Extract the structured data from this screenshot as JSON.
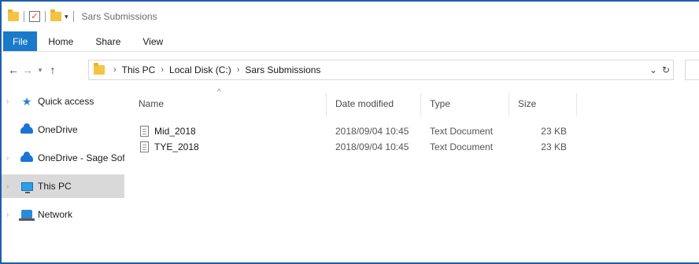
{
  "window": {
    "title": "Sars Submissions"
  },
  "ribbon": {
    "tabs": [
      "File",
      "Home",
      "Share",
      "View"
    ]
  },
  "address": {
    "crumbs": [
      "This PC",
      "Local Disk (C:)",
      "Sars Submissions"
    ]
  },
  "nav_pane": {
    "items": [
      {
        "label": "Quick access",
        "icon": "star-icon"
      },
      {
        "label": "OneDrive",
        "icon": "cloud-icon"
      },
      {
        "label": "OneDrive - Sage Softw",
        "icon": "cloud-icon"
      },
      {
        "label": "This PC",
        "icon": "computer-icon",
        "selected": true
      },
      {
        "label": "Network",
        "icon": "network-icon"
      }
    ]
  },
  "file_list": {
    "columns": [
      "Name",
      "Date modified",
      "Type",
      "Size"
    ],
    "rows": [
      {
        "name": "Mid_2018",
        "date": "2018/09/04 10:45",
        "type": "Text Document",
        "size": "23 KB"
      },
      {
        "name": "TYE_2018",
        "date": "2018/09/04 10:45",
        "type": "Text Document",
        "size": "23 KB"
      }
    ]
  },
  "colors": {
    "accent": "#1979ca",
    "selection": "#d9d9d9",
    "folder": "#f5c342"
  }
}
